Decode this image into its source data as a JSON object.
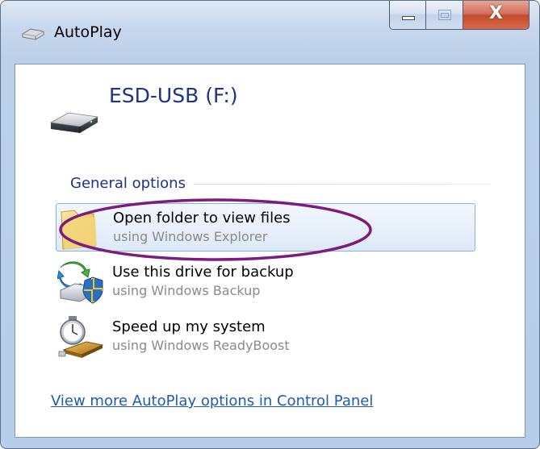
{
  "window": {
    "title": "AutoPlay",
    "close_glyph": "X"
  },
  "device": {
    "name": "ESD-USB (F:)",
    "icon": "usb-drive-icon"
  },
  "section": {
    "header": "General options"
  },
  "options": [
    {
      "title": "Open folder to view files",
      "subtitle": "using Windows Explorer",
      "icon": "folder-icon",
      "selected": true
    },
    {
      "title": "Use this drive for backup",
      "subtitle": "using Windows Backup",
      "icon": "backup-icon",
      "selected": false
    },
    {
      "title": "Speed up my system",
      "subtitle": "using Windows ReadyBoost",
      "icon": "readyboost-icon",
      "selected": false
    }
  ],
  "footer": {
    "link": "View more AutoPlay options in Control Panel"
  },
  "colors": {
    "heading_blue": "#1e3287",
    "link_blue": "#1d5bb3",
    "annotation_purple": "#7b1c7e"
  }
}
